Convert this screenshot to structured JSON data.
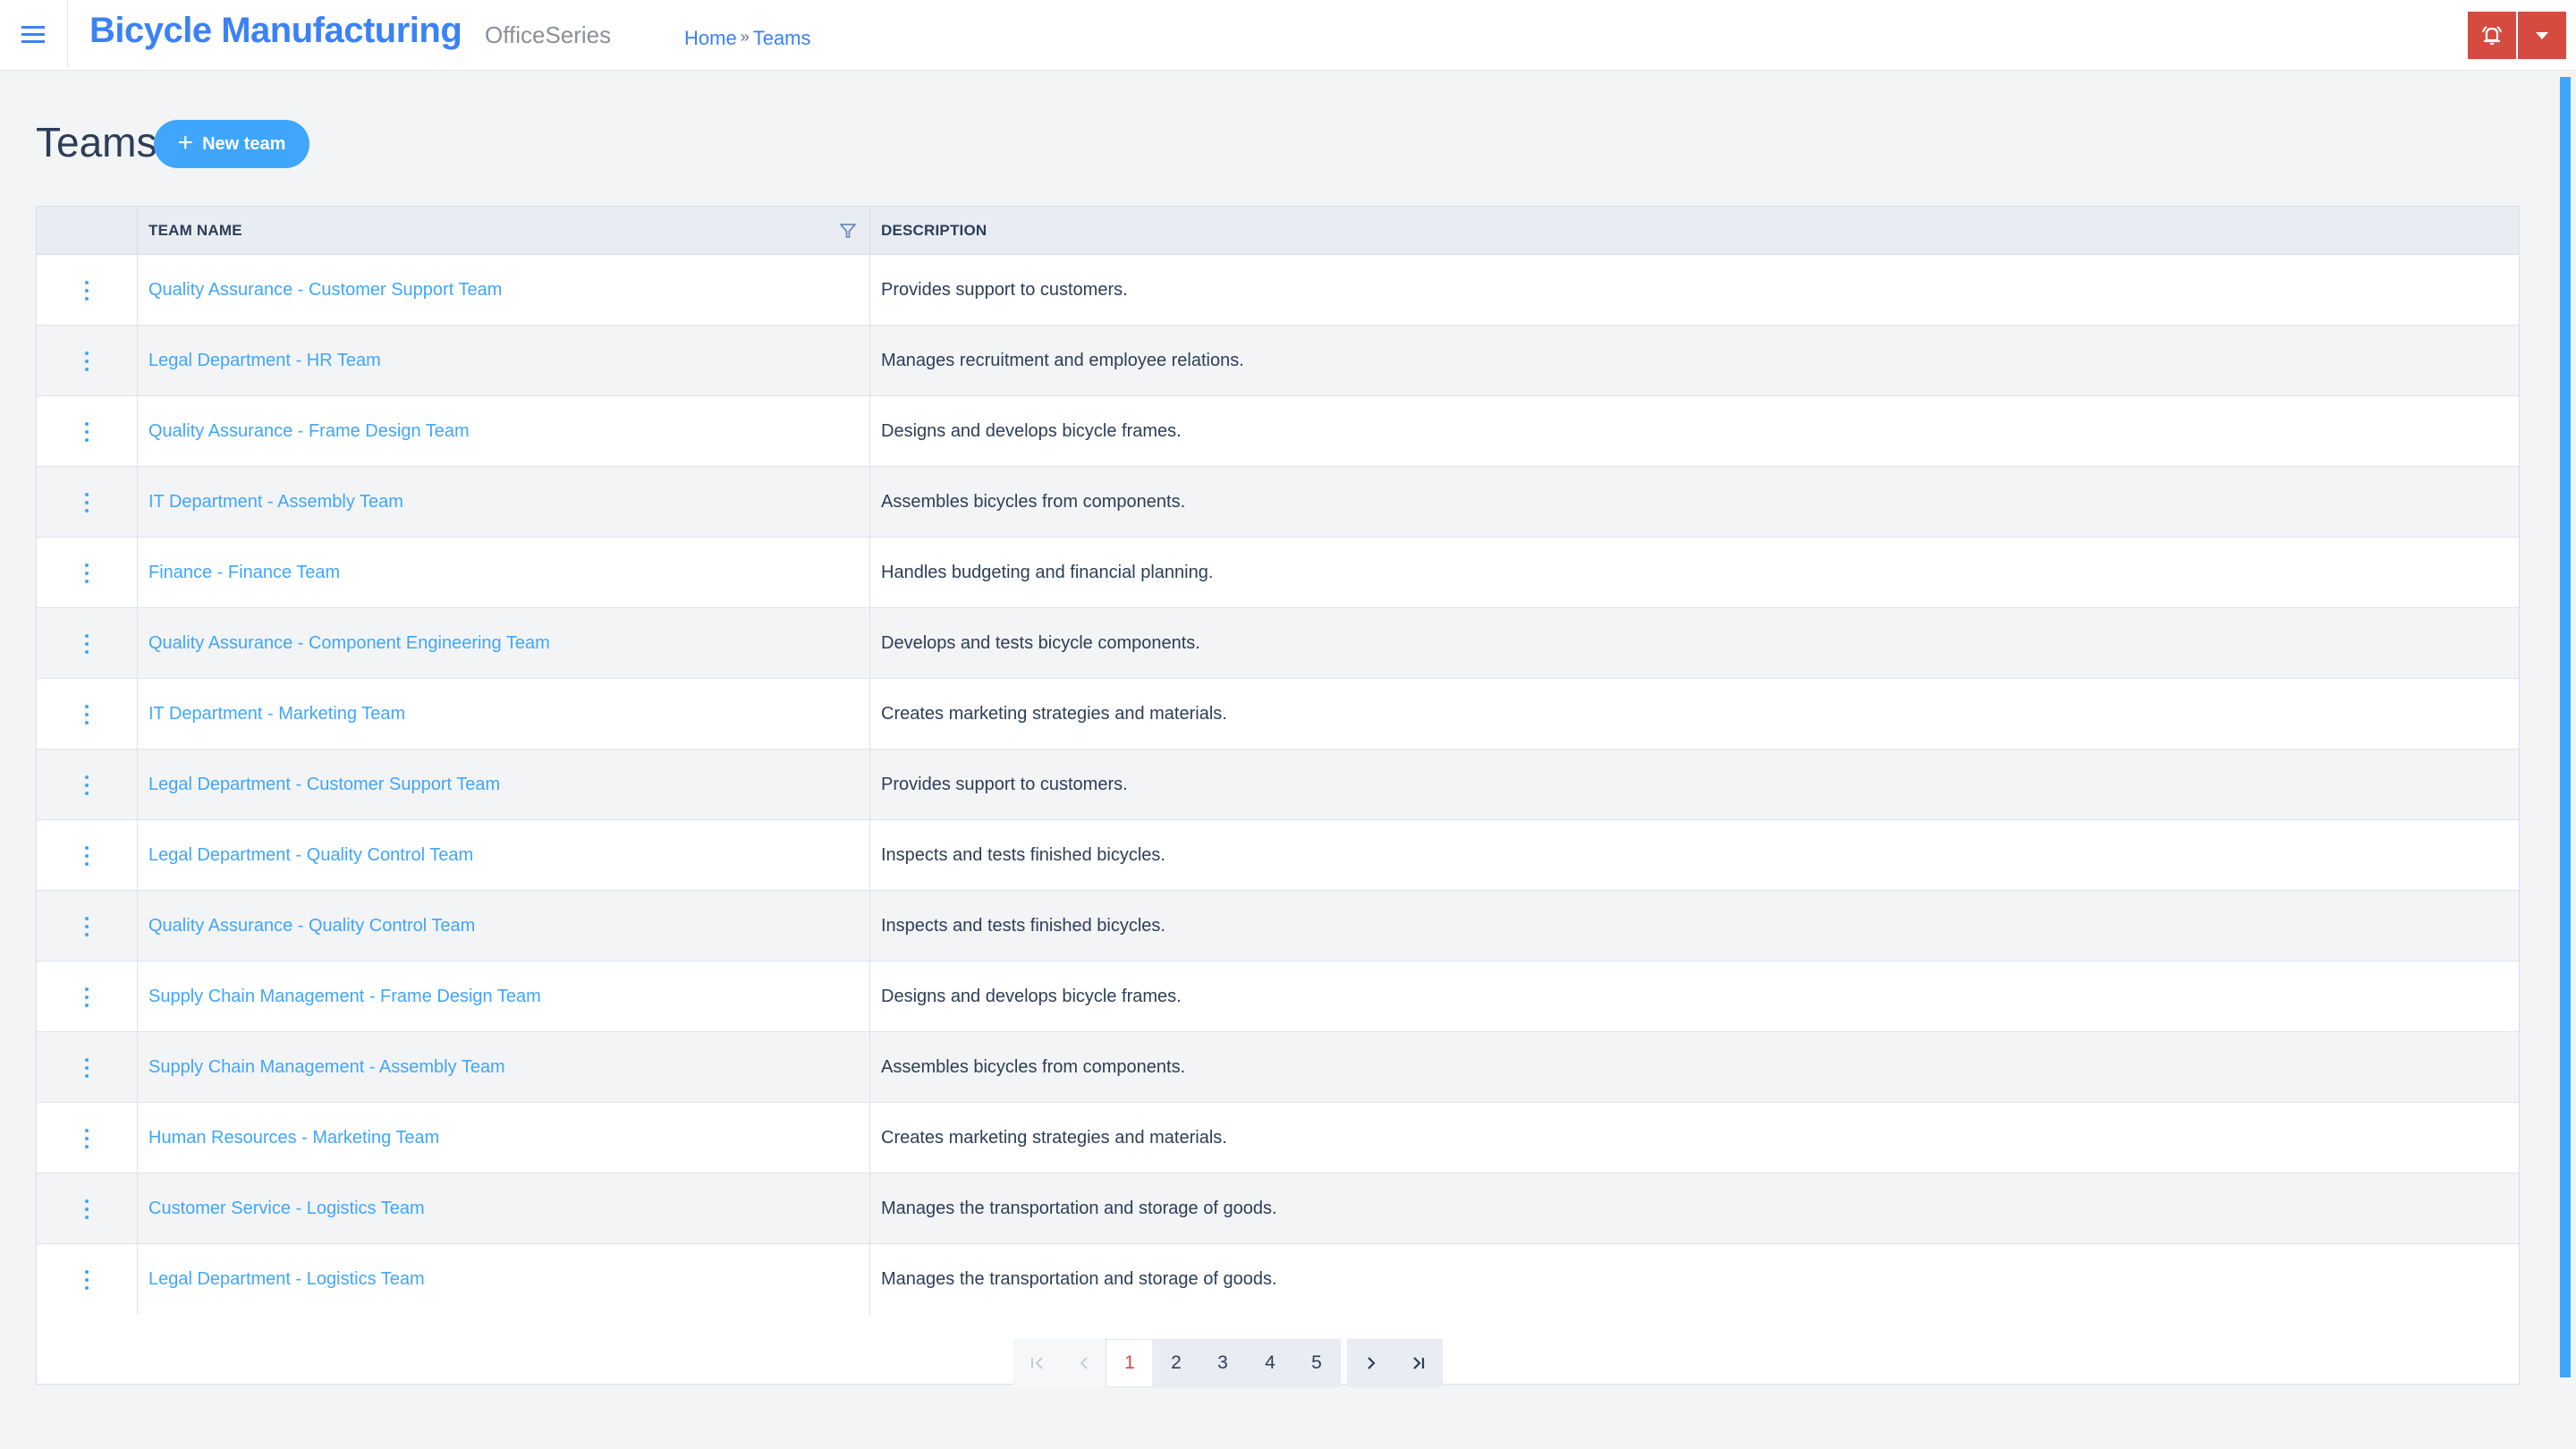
{
  "header": {
    "app_title": "Bicycle Manufacturing",
    "app_subtitle": "OfficeSeries",
    "breadcrumb": [
      {
        "label": "Home"
      },
      {
        "label": "Teams"
      }
    ],
    "breadcrumb_separator": "»",
    "icons": {
      "menu": "hamburger-icon",
      "alerts": "bell-icon",
      "dropdown": "caret-down-icon"
    },
    "accent_color": "#3b82f6",
    "alert_color": "#d64b3f"
  },
  "page": {
    "title": "Teams",
    "new_button_label": "New team",
    "new_button_icon": "plus-icon",
    "button_color": "#3fa6fb"
  },
  "table": {
    "columns": [
      {
        "label": ""
      },
      {
        "label": "TEAM NAME",
        "filter_icon": "filter-icon"
      },
      {
        "label": "DESCRIPTION"
      }
    ],
    "rows": [
      {
        "name": "Quality Assurance - Customer Support Team",
        "description": "Provides support to customers."
      },
      {
        "name": "Legal Department - HR Team",
        "description": "Manages recruitment and employee relations."
      },
      {
        "name": "Quality Assurance - Frame Design Team",
        "description": "Designs and develops bicycle frames."
      },
      {
        "name": "IT Department - Assembly Team",
        "description": "Assembles bicycles from components."
      },
      {
        "name": "Finance - Finance Team",
        "description": "Handles budgeting and financial planning."
      },
      {
        "name": "Quality Assurance - Component Engineering Team",
        "description": "Develops and tests bicycle components."
      },
      {
        "name": "IT Department - Marketing Team",
        "description": "Creates marketing strategies and materials."
      },
      {
        "name": "Legal Department - Customer Support Team",
        "description": "Provides support to customers."
      },
      {
        "name": "Legal Department - Quality Control Team",
        "description": "Inspects and tests finished bicycles."
      },
      {
        "name": "Quality Assurance - Quality Control Team",
        "description": "Inspects and tests finished bicycles."
      },
      {
        "name": "Supply Chain Management - Frame Design Team",
        "description": "Designs and develops bicycle frames."
      },
      {
        "name": "Supply Chain Management - Assembly Team",
        "description": "Assembles bicycles from components."
      },
      {
        "name": "Human Resources - Marketing Team",
        "description": "Creates marketing strategies and materials."
      },
      {
        "name": "Customer Service - Logistics Team",
        "description": "Manages the transportation and storage of goods."
      },
      {
        "name": "Legal Department - Logistics Team",
        "description": "Manages the transportation and storage of goods."
      }
    ],
    "row_action_icon": "kebab-menu-icon"
  },
  "pagination": {
    "first_icon": "first-page-icon",
    "prev_icon": "prev-page-icon",
    "next_icon": "next-page-icon",
    "last_icon": "last-page-icon",
    "pages": [
      "1",
      "2",
      "3",
      "4",
      "5"
    ],
    "current_page": "1"
  }
}
